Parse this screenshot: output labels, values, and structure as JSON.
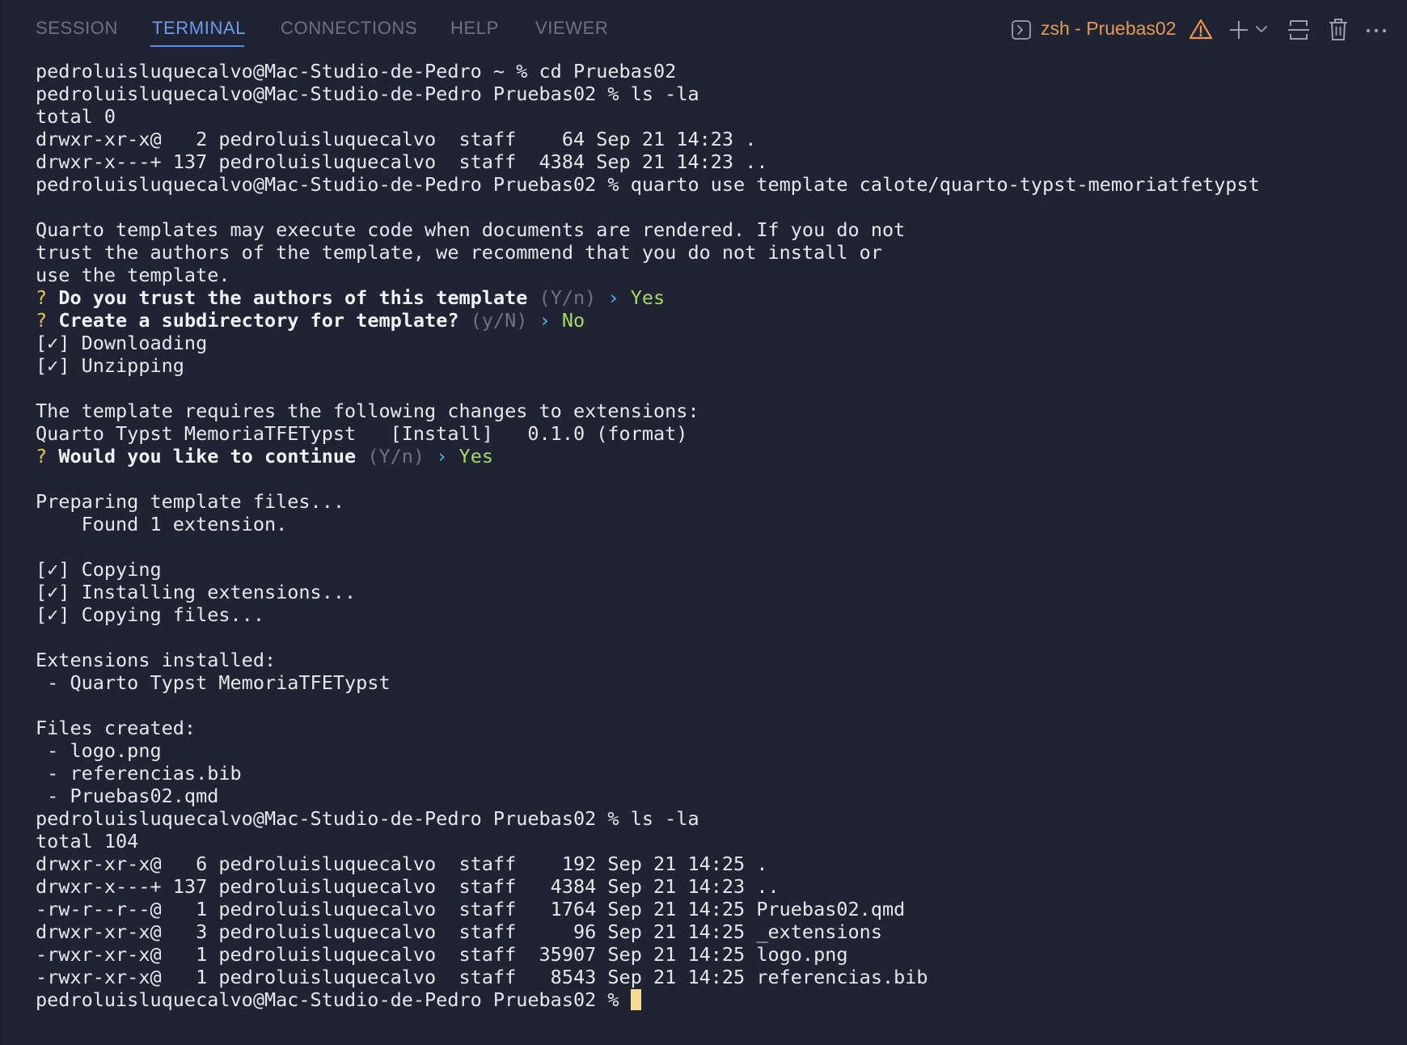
{
  "tabs": [
    {
      "label": "SESSION",
      "active": false
    },
    {
      "label": "TERMINAL",
      "active": true
    },
    {
      "label": "CONNECTIONS",
      "active": false
    },
    {
      "label": "HELP",
      "active": false
    },
    {
      "label": "VIEWER",
      "active": false
    }
  ],
  "toolbar": {
    "shell_label": "zsh - Pruebas02",
    "icons": [
      "terminal-icon",
      "warning-icon",
      "plus-icon",
      "chevron-down-icon",
      "split-terminal-icon",
      "trash-icon",
      "more-icon"
    ]
  },
  "colors": {
    "background": "#1f2332",
    "tab_active": "#6f9bf0",
    "tab_inactive": "#6c7285",
    "shell_label": "#e69a55",
    "prompt_question": "#e8c35a",
    "answer": "#a6d96a",
    "arrow": "#5db3f0",
    "cursor": "#f3dc95"
  },
  "terminal": {
    "lines": [
      "pedroluisluquecalvo@Mac-Studio-de-Pedro ~ % cd Pruebas02",
      "pedroluisluquecalvo@Mac-Studio-de-Pedro Pruebas02 % ls -la",
      "total 0",
      "drwxr-xr-x@   2 pedroluisluquecalvo  staff    64 Sep 21 14:23 .",
      "drwxr-x---+ 137 pedroluisluquecalvo  staff  4384 Sep 21 14:23 ..",
      "pedroluisluquecalvo@Mac-Studio-de-Pedro Pruebas02 % quarto use template calote/quarto-typst-memoriatfetypst",
      "",
      "Quarto templates may execute code when documents are rendered. If you do not",
      "trust the authors of the template, we recommend that you do not install or",
      "use the template."
    ],
    "prompt1": {
      "mark": "?",
      "question": "Do you trust the authors of this template",
      "hint": "(Y/n)",
      "arrow": "›",
      "answer": "Yes"
    },
    "prompt2": {
      "mark": "?",
      "question": "Create a subdirectory for template?",
      "hint": "(y/N)",
      "arrow": "›",
      "answer": "No"
    },
    "lines2": [
      "[✓] Downloading",
      "[✓] Unzipping",
      "",
      "The template requires the following changes to extensions:",
      "Quarto Typst MemoriaTFETypst   [Install]   0.1.0 (format)"
    ],
    "prompt3": {
      "mark": "?",
      "question": "Would you like to continue",
      "hint": "(Y/n)",
      "arrow": "›",
      "answer": "Yes"
    },
    "lines3": [
      "",
      "Preparing template files...",
      "    Found 1 extension.",
      "",
      "[✓] Copying",
      "[✓] Installing extensions...",
      "[✓] Copying files...",
      "",
      "Extensions installed:",
      " - Quarto Typst MemoriaTFETypst",
      "",
      "Files created:",
      " - logo.png",
      " - referencias.bib",
      " - Pruebas02.qmd",
      "pedroluisluquecalvo@Mac-Studio-de-Pedro Pruebas02 % ls -la",
      "total 104",
      "drwxr-xr-x@   6 pedroluisluquecalvo  staff    192 Sep 21 14:25 .",
      "drwxr-x---+ 137 pedroluisluquecalvo  staff   4384 Sep 21 14:23 ..",
      "-rw-r--r--@   1 pedroluisluquecalvo  staff   1764 Sep 21 14:25 Pruebas02.qmd",
      "drwxr-xr-x@   3 pedroluisluquecalvo  staff     96 Sep 21 14:25 _extensions",
      "-rwxr-xr-x@   1 pedroluisluquecalvo  staff  35907 Sep 21 14:25 logo.png",
      "-rwxr-xr-x@   1 pedroluisluquecalvo  staff   8543 Sep 21 14:25 referencias.bib"
    ],
    "final_prompt": "pedroluisluquecalvo@Mac-Studio-de-Pedro Pruebas02 % "
  }
}
